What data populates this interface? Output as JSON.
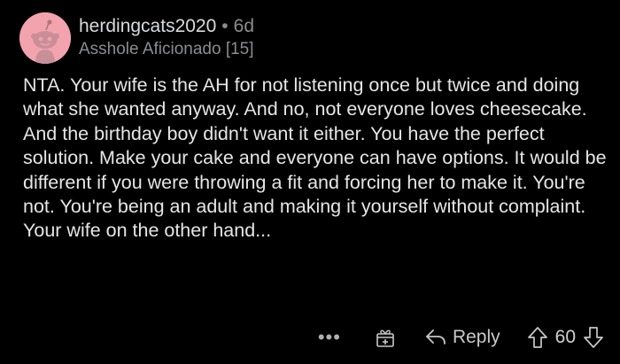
{
  "comment": {
    "username": "herdingcats2020",
    "separator": "•",
    "age": "6d",
    "flair": "Asshole Aficionado [15]",
    "body": "NTA. Your wife is the AH for not listening once but twice and doing what she wanted anyway. And no, not everyone loves cheesecake. And the birthday boy didn't want it either. You have the perfect solution. Make your cake and everyone can have options. It would be different if you were throwing a fit and forcing her to make it. You're not. You're being an adult and making it yourself without complaint. Your wife on the other hand..."
  },
  "actions": {
    "more": "•••",
    "reply_label": "Reply",
    "vote_count": "60"
  },
  "icons": {
    "avatar": "snoo-avatar-icon",
    "award": "gift-award-icon",
    "reply": "reply-arrow-icon",
    "upvote": "upvote-arrow-icon",
    "downvote": "downvote-arrow-icon"
  },
  "colors": {
    "background": "#000000",
    "avatar_bg": "#f2a3ae",
    "text": "#e6e6e6",
    "muted": "#8a8d8f"
  }
}
